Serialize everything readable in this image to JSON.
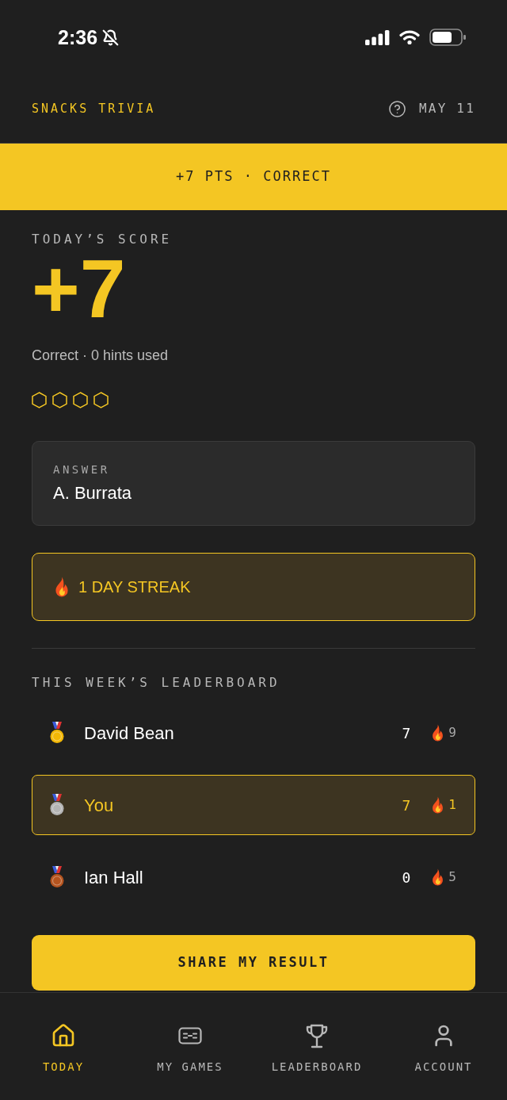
{
  "status_bar": {
    "time": "2:36"
  },
  "header": {
    "title": "SNACKS TRIVIA",
    "date": "MAY 11"
  },
  "banner": {
    "text": "+7 PTS · CORRECT"
  },
  "score": {
    "label": "TODAY’S SCORE",
    "value": "+7",
    "summary": "Correct · 0 hints used",
    "hint_markers": [
      {
        "filled": false
      },
      {
        "filled": false
      },
      {
        "filled": false
      },
      {
        "filled": false
      }
    ]
  },
  "answer": {
    "label": "ANSWER",
    "value": "A. Burrata"
  },
  "streak": {
    "text": "1 DAY STREAK"
  },
  "leaderboard": {
    "title": "THIS WEEK’S LEADERBOARD",
    "rows": [
      {
        "name": "David Bean",
        "points": "7",
        "streak": "9",
        "color": "#f2b705",
        "selected": false
      },
      {
        "name": "You",
        "points": "7",
        "streak": "1",
        "color": "#b4b4b4",
        "selected": true
      },
      {
        "name": "Ian Hall",
        "points": "0",
        "streak": "5",
        "color": "#b5541f",
        "selected": false
      }
    ]
  },
  "share_button": {
    "label": "SHARE MY RESULT"
  },
  "nav": [
    {
      "label": "TODAY",
      "selected": true
    },
    {
      "label": "MY GAMES",
      "selected": false
    },
    {
      "label": "LEADERBOARD",
      "selected": false
    },
    {
      "label": "ACCOUNT",
      "selected": false
    }
  ]
}
